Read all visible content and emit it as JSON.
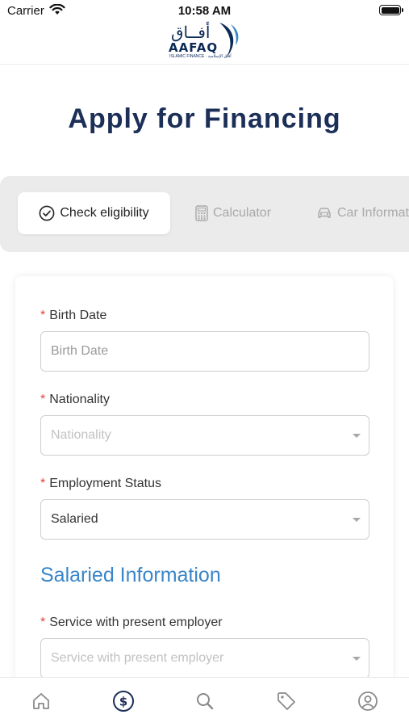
{
  "status_bar": {
    "carrier": "Carrier",
    "time": "10:58 AM"
  },
  "header": {
    "logo_arabic": "أفــاق",
    "logo_text": "AAFAQ",
    "logo_tagline": "ISLAMIC FINANCE · آفاق الإسلامية"
  },
  "page": {
    "title": "Apply for Financing"
  },
  "tabs": [
    {
      "label": "Check eligibility",
      "icon": "check-circle-icon",
      "active": true
    },
    {
      "label": "Calculator",
      "icon": "calculator-icon",
      "active": false
    },
    {
      "label": "Car Informat",
      "icon": "car-icon",
      "active": false
    }
  ],
  "form": {
    "birth_date": {
      "label": "Birth Date",
      "placeholder": "Birth Date",
      "value": ""
    },
    "nationality": {
      "label": "Nationality",
      "placeholder": "Nationality",
      "value": ""
    },
    "employment_status": {
      "label": "Employment Status",
      "value": "Salaried"
    },
    "section_title": "Salaried Information",
    "service_with_employer": {
      "label": "Service with present employer",
      "placeholder": "Service with present employer",
      "value": ""
    },
    "required_marker": "*"
  },
  "bottom_nav": [
    {
      "name": "home-icon",
      "active": false
    },
    {
      "name": "financing-icon",
      "active": true
    },
    {
      "name": "search-icon",
      "active": false
    },
    {
      "name": "tag-icon",
      "active": false
    },
    {
      "name": "profile-icon",
      "active": false
    }
  ],
  "colors": {
    "primary_navy": "#1b2f57",
    "accent_blue": "#3a86c8",
    "required_red": "#e0453a",
    "tab_strip_bg": "#ebebeb",
    "inactive_gray": "#a9a9a9"
  }
}
